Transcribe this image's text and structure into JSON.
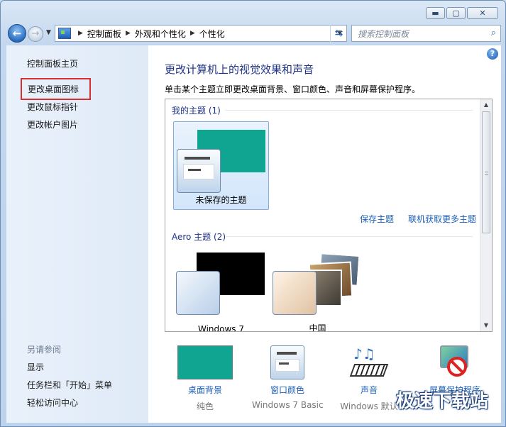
{
  "window": {
    "buttons": {
      "minimize": "▬",
      "maximize": "▢",
      "close": "✕"
    }
  },
  "nav": {
    "back_icon": "back-arrow-icon",
    "forward_icon": "forward-arrow-icon",
    "breadcrumb": [
      "控制面板",
      "外观和个性化",
      "个性化"
    ],
    "search_placeholder": "搜索控制面板"
  },
  "sidebar": {
    "home": "控制面板主页",
    "links": [
      "更改桌面图标",
      "更改鼠标指针",
      "更改帐户图片"
    ],
    "see_also_title": "另请参阅",
    "see_also": [
      "显示",
      "任务栏和「开始」菜单",
      "轻松访问中心"
    ]
  },
  "main": {
    "title": "更改计算机上的视觉效果和声音",
    "description": "单击某个主题立即更改桌面背景、窗口颜色、声音和屏幕保护程序。",
    "my_themes": {
      "title": "我的主题 (1)",
      "items": [
        {
          "label": "未保存的主题",
          "wallpaper_color": "#10a591",
          "selected": true
        }
      ]
    },
    "links": {
      "save": "保存主题",
      "more": "联机获取更多主题"
    },
    "aero_themes": {
      "title": "Aero 主题 (2)",
      "items": [
        {
          "label": "Windows 7",
          "wallpaper_color": "#000000"
        },
        {
          "label": "中国",
          "wallpaper_color": "#c8935a"
        }
      ]
    },
    "bottom": {
      "background": {
        "label": "桌面背景",
        "sub": "纯色"
      },
      "window_color": {
        "label": "窗口颜色",
        "sub": "Windows 7 Basic"
      },
      "sound": {
        "label": "声音",
        "sub": "Windows 默认"
      },
      "screensaver": {
        "label": "屏幕保护程序",
        "sub": ""
      }
    }
  },
  "watermark": "极速下载站",
  "colors": {
    "accent": "#1b5fb6",
    "teal": "#10a591",
    "highlight_border": "#d83030"
  }
}
